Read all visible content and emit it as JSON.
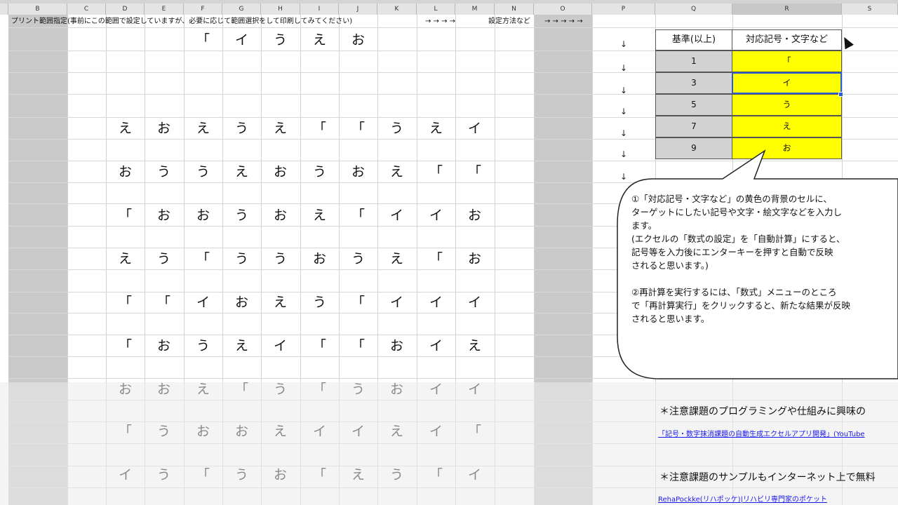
{
  "columns": [
    "B",
    "C",
    "D",
    "E",
    "F",
    "G",
    "H",
    "I",
    "J",
    "K",
    "L",
    "M",
    "N",
    "O",
    "P",
    "Q",
    "R",
    "S"
  ],
  "selected_column": "R",
  "print_note": "プリント範囲指定(事前にこの範囲で設定していますが、必要に応じて範囲選択をして印刷してみてください)",
  "arrows_mid": "→ → → →",
  "setting_label": "設定方法など",
  "arrows_right": "→ → → → →",
  "down_arrow": "↓",
  "grid_top_row": [
    "「",
    "イ",
    "う",
    "え",
    "お"
  ],
  "grid_rows": [
    [
      "え",
      "お",
      "え",
      "う",
      "え",
      "「",
      "「",
      "う",
      "え",
      "イ"
    ],
    [
      "お",
      "う",
      "う",
      "え",
      "お",
      "う",
      "お",
      "え",
      "「",
      "「"
    ],
    [
      "「",
      "お",
      "お",
      "う",
      "お",
      "え",
      "「",
      "イ",
      "イ",
      "お"
    ],
    [
      "え",
      "う",
      "「",
      "う",
      "う",
      "お",
      "う",
      "え",
      "「",
      "お"
    ],
    [
      "「",
      "「",
      "イ",
      "お",
      "え",
      "う",
      "「",
      "イ",
      "イ",
      "イ"
    ],
    [
      "「",
      "お",
      "う",
      "え",
      "イ",
      "「",
      "「",
      "お",
      "イ",
      "え"
    ],
    [
      "お",
      "お",
      "え",
      "「",
      "う",
      "「",
      "う",
      "お",
      "イ",
      "イ"
    ],
    [
      "「",
      "う",
      "お",
      "お",
      "え",
      "イ",
      "イ",
      "え",
      "イ",
      "「"
    ],
    [
      "イ",
      "う",
      "「",
      "う",
      "お",
      "「",
      "え",
      "う",
      "「",
      "イ"
    ]
  ],
  "table": {
    "header_left": "基準(以上)",
    "header_right": "対応記号・文字など",
    "rows": [
      {
        "threshold": "1",
        "symbol": "「"
      },
      {
        "threshold": "3",
        "symbol": "イ"
      },
      {
        "threshold": "5",
        "symbol": "う"
      },
      {
        "threshold": "7",
        "symbol": "え"
      },
      {
        "threshold": "9",
        "symbol": "お"
      }
    ]
  },
  "bubble": [
    "①「対応記号・文字など」の黄色の背景のセルに、",
    "ターゲットにしたい記号や文字・絵文字などを入力し",
    "ます。",
    "(エクセルの「数式の設定」を「自動計算」にすると、",
    "記号等を入力後にエンターキーを押すと自動で反映",
    "されると思います。)",
    "",
    "②再計算を実行するには、「数式」メニューのところ",
    "で「再計算実行」をクリックすると、新たな結果が反映",
    "されると思います。"
  ],
  "info1": "＊注意課題のプログラミングや仕組みに興味の",
  "link1": "「記号・数字抹消課題の自動生成エクセルアプリ開発」(YouTube",
  "info2": "＊注意課題のサンプルもインターネット上で無料",
  "link2": "RehaPockke(リハポッケ)|リハビリ専門家のポケット"
}
